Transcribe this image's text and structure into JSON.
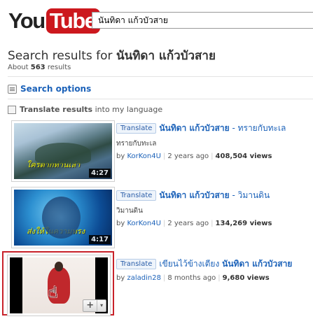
{
  "logo": {
    "part1": "You",
    "part2": "Tube"
  },
  "search": {
    "value": "นันทิดา แก้วบัวสาย"
  },
  "header": {
    "title_prefix": "Search results for",
    "title_query": "นันทิดา แก้วบัวสาย",
    "about_prefix": "About",
    "about_count": "563",
    "about_suffix": "results"
  },
  "search_options": {
    "label": "Search options"
  },
  "translate_toggle": {
    "label_bold": "Translate results",
    "label_rest": "into my language"
  },
  "results": [
    {
      "translate_label": "Translate",
      "title_bold": "นันทิดา แก้วบัวสาย",
      "title_rest": " - ทรายกับทะเล",
      "description": "ทรายกับทะเล",
      "by": "by",
      "author": "KorKon4U",
      "age": "2 years ago",
      "views": "408,504 views",
      "duration": "4:27",
      "thumb_caption": "ใครตากท่านเล่า"
    },
    {
      "translate_label": "Translate",
      "title_bold": "นันทิดา แก้วบัวสาย",
      "title_rest": " - วิมานดิน",
      "description": "วิมานดิน",
      "by": "by",
      "author": "KorKon4U",
      "age": "2 years ago",
      "views": "134,269 views",
      "duration": "4:17",
      "thumb_caption": "ส่งให้ในความทรง"
    },
    {
      "translate_label": "Translate",
      "title_rest_pre": "เขียนไว้ข้างเตียง ",
      "title_bold": "นันทิดา แก้วบัวสาย",
      "by": "by",
      "author": "zaladin28",
      "age": "8 months ago",
      "views": "9,680 views",
      "add_button": "+",
      "add_arrow": "▾"
    }
  ],
  "colors": {
    "brand_red": "#cc181e",
    "link_blue": "#1c62b9",
    "highlight_red": "#c8222a"
  }
}
